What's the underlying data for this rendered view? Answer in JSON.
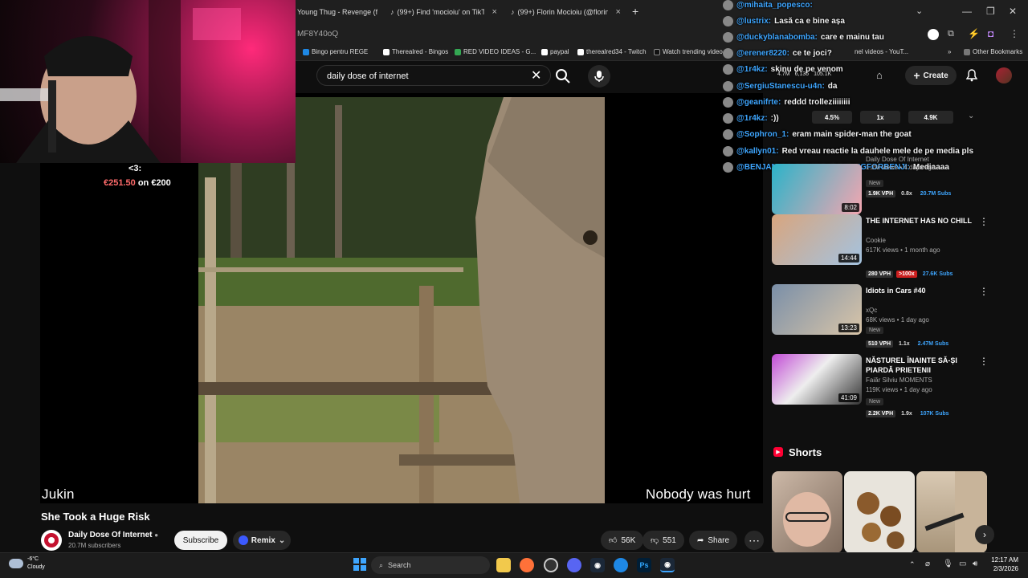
{
  "browser": {
    "tabs": [
      {
        "label": "Young Thug - Revenge (fea"
      },
      {
        "label": "(99+) Find 'mocioiu' on TikTok |"
      },
      {
        "label": "(99+) Florin Mocioiu (@florinm"
      }
    ],
    "new_tab": "+",
    "url": "MF8Y40oQ",
    "bookmarks": [
      {
        "label": "Bingo pentru REGE",
        "color": "#e53935"
      },
      {
        "label": "Therealred - Bingos",
        "color": "#ffffff"
      },
      {
        "label": "RED VIDEO IDEAS - G...",
        "color": "#34a853"
      },
      {
        "label": "paypal",
        "color": "#ffffff"
      },
      {
        "label": "therealred34 - Twitch",
        "color": "#ffffff"
      },
      {
        "label": "Watch trending video",
        "color": "#111111"
      },
      {
        "label": "nel videos - YouT...",
        "color": "#ff0000"
      }
    ],
    "other_bookmarks": "Other Bookmarks"
  },
  "youtube": {
    "search_query": "daily dose of internet",
    "create_label": "Create",
    "video": {
      "caption_left": "Jukin",
      "caption_right": "Nobody was hurt",
      "title": "She Took a Huge Risk",
      "channel": "Daily Dose Of Internet",
      "subscribers": "20.7M subscribers",
      "subscribe_label": "Subscribe",
      "remix_label": "Remix",
      "likes": "56K",
      "dislikes": "551",
      "share_label": "Share"
    },
    "overlay_stats": {
      "views": "4.7M",
      "a": "6,136",
      "b": "105.1K"
    },
    "rates": [
      "4.5%",
      "1x",
      "4.9K"
    ],
    "recommendations": [
      {
        "title": "",
        "channel": "Daily Dose Of Internet",
        "meta": "1.2M views • 4 days ago",
        "duration": "8:02",
        "vph": "1.9K VPH",
        "mult": "0.8x",
        "subs": "20.7M Subs",
        "new": "New"
      },
      {
        "title": "THE INTERNET HAS NO CHILL",
        "channel": "Cookie",
        "meta": "617K views • 1 month ago",
        "duration": "14:44",
        "vph": "280 VPH",
        "mult": ">100x",
        "subs": "27.6K Subs",
        "new": ""
      },
      {
        "title": "Idiots in Cars #40",
        "channel": "xQc",
        "meta": "68K views • 1 day ago",
        "duration": "13:23",
        "vph": "510 VPH",
        "mult": "1.1x",
        "subs": "2.47M Subs",
        "new": "New"
      },
      {
        "title": "NĂSTUREL ÎNAINTE SĂ-ȘI PIARDĂ PRIETENII",
        "channel": "Faiăr Silviu MOMENTS",
        "meta": "119K views • 1 day ago",
        "duration": "41:09",
        "vph": "2.2K VPH",
        "mult": "1.9x",
        "subs": "107K Subs",
        "new": "New"
      }
    ],
    "shorts_label": "Shorts"
  },
  "stream": {
    "donation_icon": "<3:",
    "donation_amount": "€251.50",
    "donation_goal": "on €200",
    "chat": [
      {
        "user": "@mihaita_popesco:",
        "msg": "",
        "color": "#3ea6ff"
      },
      {
        "user": "@lustrix:",
        "msg": "Lasă ca e bine așa",
        "color": "#ffffff"
      },
      {
        "user": "@duckyblanabomba:",
        "msg": "care e mainu tau",
        "color": "#3ea6ff"
      },
      {
        "user": "@erener8220:",
        "msg": "ce te joci?",
        "color": "#ffffff"
      },
      {
        "user": "@1r4kz:",
        "msg": "skinu de pe venom",
        "color": "#3ea6ff"
      },
      {
        "user": "@SergiuStanescu-u4n:",
        "msg": "da",
        "color": "#3ea6ff"
      },
      {
        "user": "@geanifrte:",
        "msg": "reddd trolleziiiiiiii",
        "color": "#ffffff"
      },
      {
        "user": "@1r4kz:",
        "msg": ":))",
        "color": "#3ea6ff"
      },
      {
        "user": "@Sophron_1:",
        "msg": "eram main spider-man the goat",
        "color": "#3ea6ff"
      },
      {
        "user": "@kallyn01:",
        "msg": "Red vreau reactie la dauhele mele de pe media pls",
        "color": "#3ea6ff"
      },
      {
        "user": "@BENJAMINYEAHIWASLOOKINGFORBENJI:",
        "msg": "Mediaaaa",
        "color": "#3ea6ff"
      }
    ]
  },
  "taskbar": {
    "search_label": "Search",
    "weather_temp": "-6°C",
    "weather_cond": "Cloudy",
    "time": "12:17 AM",
    "date": "2/3/2026"
  }
}
